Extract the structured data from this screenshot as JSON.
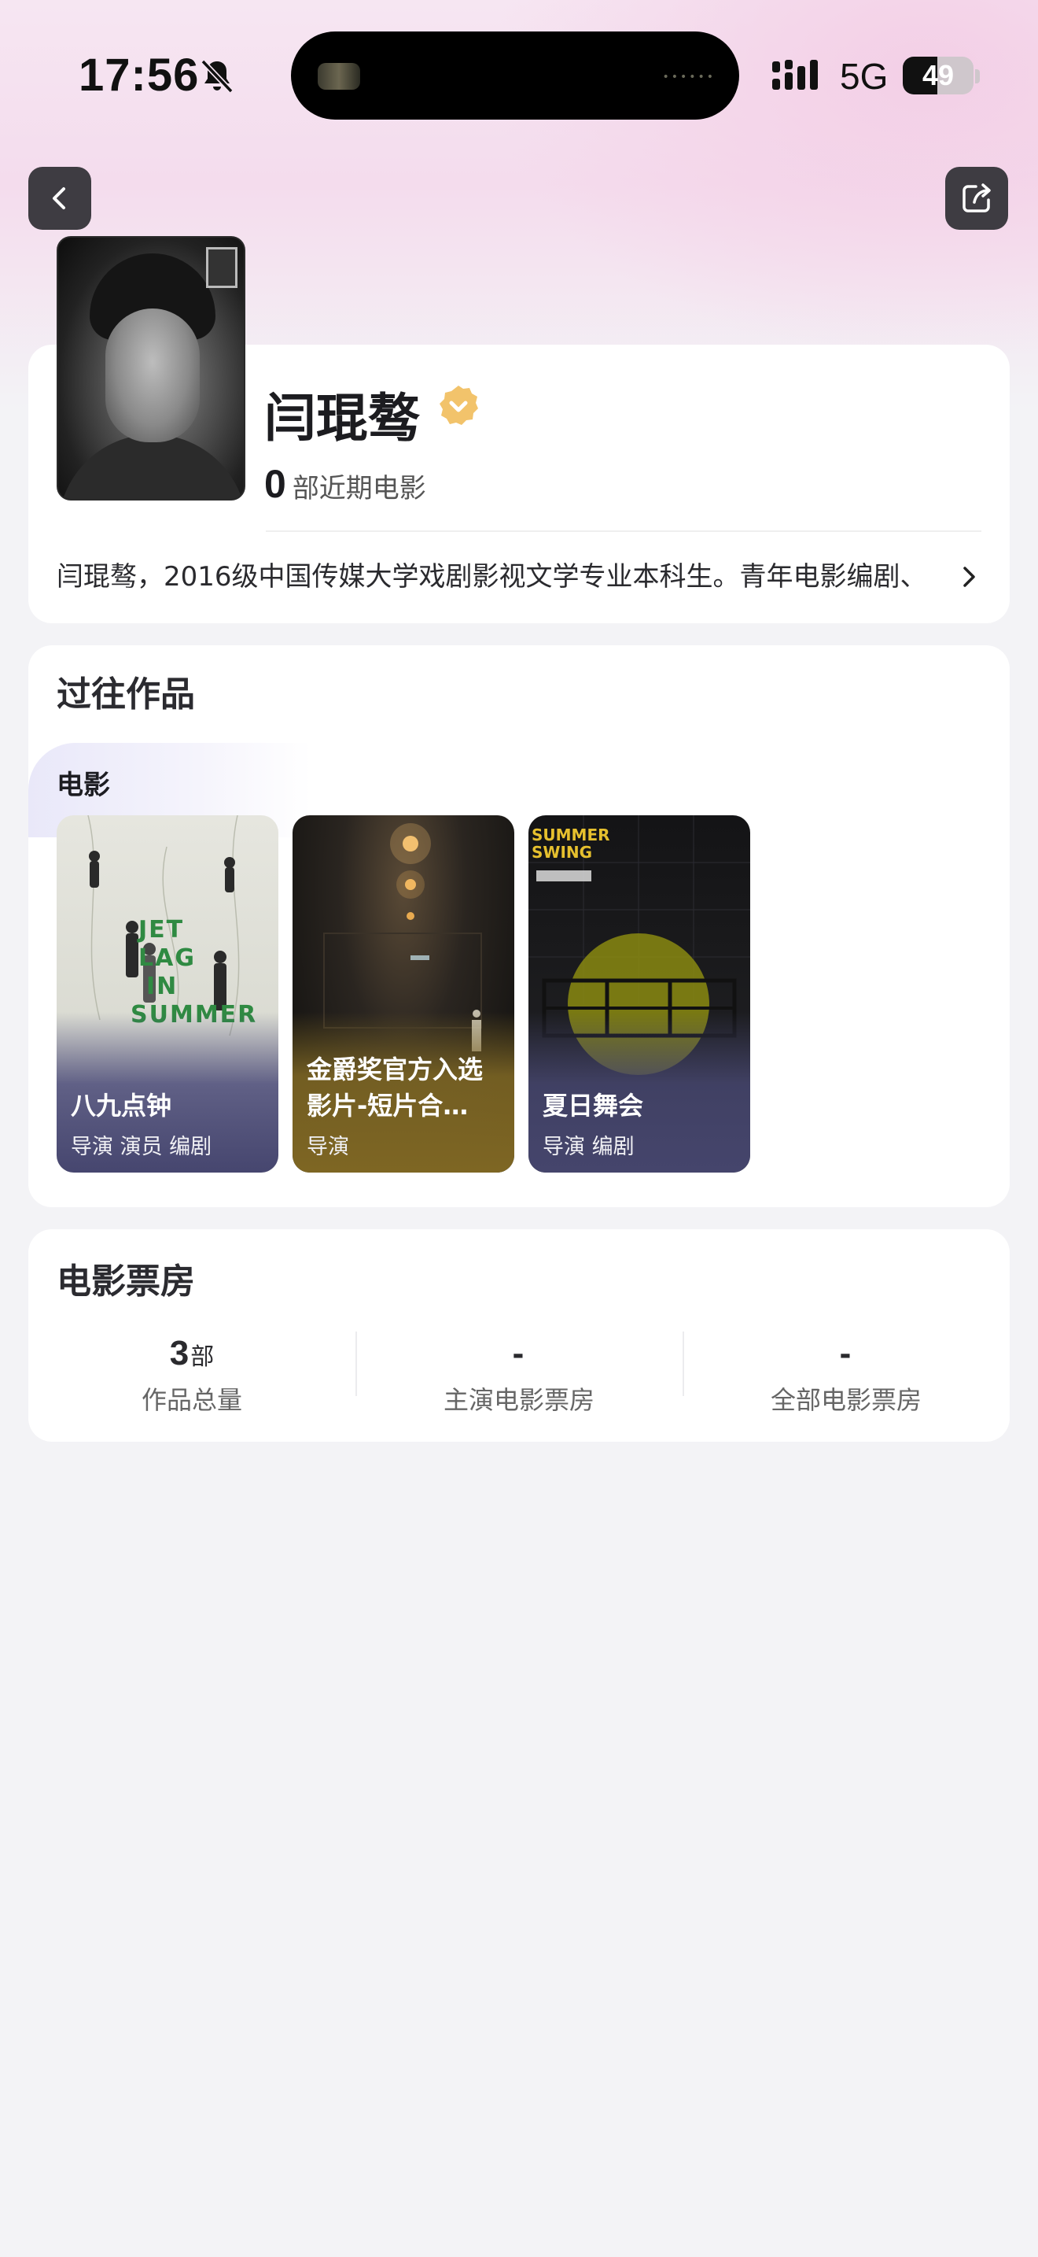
{
  "status_bar": {
    "time": "17:56",
    "network": "5G",
    "battery": "49",
    "battery_level": 0.49
  },
  "profile": {
    "name": "闫琨骜",
    "recent_count": "0",
    "recent_label": "部近期电影",
    "bio": "闫琨骜，2016级中国传媒大学戏剧影视文学专业本科生。青年电影编剧、"
  },
  "works": {
    "title": "过往作品",
    "tab": "电影",
    "films": [
      {
        "title": "八九点钟",
        "roles": "导演 演员 编剧",
        "poster_lines": [
          "JET",
          "LAG",
          "IN",
          "SUMMER"
        ]
      },
      {
        "title": "金爵奖官方入选影片-短片合…",
        "roles": "导演"
      },
      {
        "title": "夏日舞会",
        "roles": "导演 编剧",
        "poster_lines": [
          "SUMMER",
          "SWING"
        ]
      }
    ]
  },
  "box_office": {
    "title": "电影票房",
    "stats": [
      {
        "value": "3",
        "unit": "部",
        "label": "作品总量"
      },
      {
        "value": "-",
        "unit": "",
        "label": "主演电影票房"
      },
      {
        "value": "-",
        "unit": "",
        "label": "全部电影票房"
      }
    ]
  },
  "colors": {
    "accent_badge": "#f2c36b",
    "page_bg": "#f3f3f6",
    "card_bg": "#ffffff"
  },
  "icons": [
    "bell-slash-icon",
    "signal-icon",
    "battery-icon",
    "back-icon",
    "share-icon",
    "verified-icon",
    "chevron-right-icon"
  ]
}
